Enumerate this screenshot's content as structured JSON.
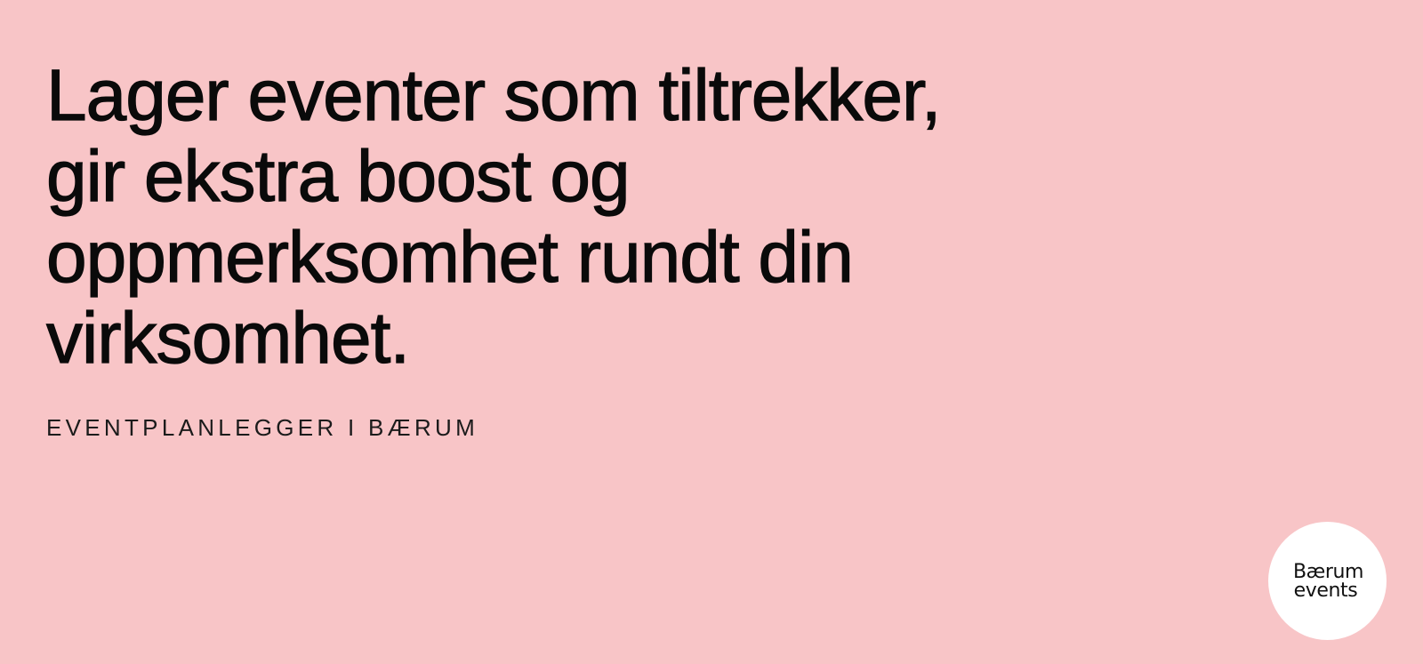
{
  "hero": {
    "headline_lines": [
      "Lager eventer som tiltrekker,",
      "gir ekstra boost og",
      "oppmerksomhet rundt din",
      "virksomhet."
    ],
    "subtitle": "EVENTPLANLEGGER I BÆRUM"
  },
  "logo": {
    "line1": "Bærum",
    "line2": "events",
    "background_color": "#ffffff"
  },
  "colors": {
    "page_background": "#f8c5c7",
    "text": "#0a0a0a"
  }
}
